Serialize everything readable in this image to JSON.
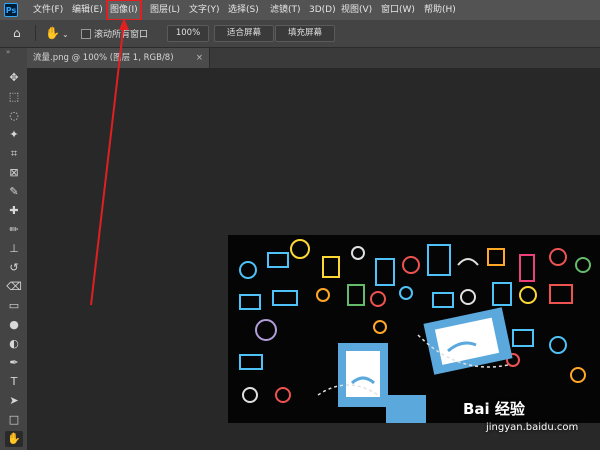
{
  "app": {
    "logo_text": "Ps"
  },
  "menubar": {
    "items": [
      {
        "label": "文件(F)"
      },
      {
        "label": "编辑(E)"
      },
      {
        "label": "图像(I)",
        "highlighted": true
      },
      {
        "label": "图层(L)"
      },
      {
        "label": "文字(Y)"
      },
      {
        "label": "选择(S)"
      },
      {
        "label": "滤镜(T)"
      },
      {
        "label": "3D(D)"
      },
      {
        "label": "视图(V)"
      },
      {
        "label": "窗口(W)"
      },
      {
        "label": "帮助(H)"
      }
    ]
  },
  "options_bar": {
    "home_icon": "home-icon",
    "tool_icon": "hand-icon",
    "scroll_all_label": "滚动所有窗口",
    "scroll_all_checked": false,
    "zoom_value": "100%",
    "fit_screen_label": "适合屏幕",
    "fill_screen_label": "填充屏幕"
  },
  "toolbar": {
    "tools": [
      {
        "name": "move-tool",
        "glyph": "✥"
      },
      {
        "name": "marquee-tool",
        "glyph": "⬚"
      },
      {
        "name": "lasso-tool",
        "glyph": "◌"
      },
      {
        "name": "magic-wand-tool",
        "glyph": "✦"
      },
      {
        "name": "crop-tool",
        "glyph": "⌗"
      },
      {
        "name": "frame-tool",
        "glyph": "⊠"
      },
      {
        "name": "eyedropper-tool",
        "glyph": "✎"
      },
      {
        "name": "healing-brush-tool",
        "glyph": "✚"
      },
      {
        "name": "brush-tool",
        "glyph": "✏"
      },
      {
        "name": "clone-stamp-tool",
        "glyph": "⊥"
      },
      {
        "name": "history-brush-tool",
        "glyph": "↺"
      },
      {
        "name": "eraser-tool",
        "glyph": "⌫"
      },
      {
        "name": "gradient-tool",
        "glyph": "▭"
      },
      {
        "name": "blur-tool",
        "glyph": "●"
      },
      {
        "name": "dodge-tool",
        "glyph": "◐"
      },
      {
        "name": "pen-tool",
        "glyph": "✒"
      },
      {
        "name": "type-tool",
        "glyph": "T"
      },
      {
        "name": "path-selection-tool",
        "glyph": "➤"
      },
      {
        "name": "rectangle-tool",
        "glyph": "□"
      },
      {
        "name": "hand-tool",
        "glyph": "✋",
        "selected": true
      }
    ]
  },
  "document": {
    "tab_title": "流量.png @ 100% (图层 1, RGB/8)",
    "close_glyph": "×"
  },
  "annotation": {
    "color": "#e02020"
  },
  "watermark": {
    "main": "Bai 经验",
    "sub": "jingyan.baidu.com"
  }
}
